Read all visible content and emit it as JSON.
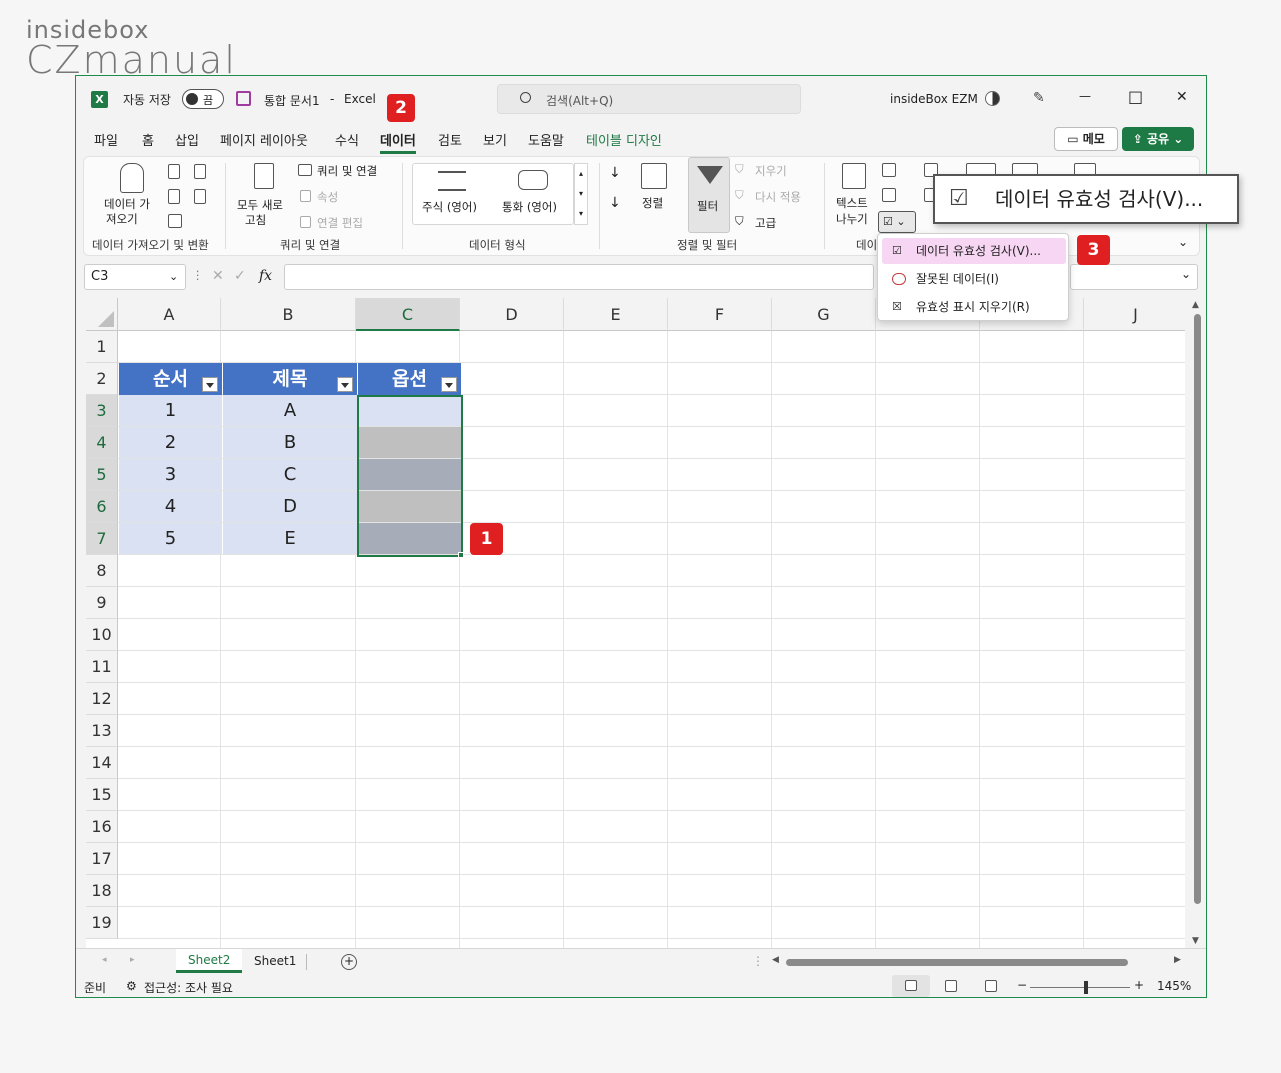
{
  "watermark": {
    "line1": "insidebox",
    "line2": "CZmanual"
  },
  "titlebar": {
    "autosave_label": "자동 저장",
    "autosave_state": "끔",
    "doc_name": "통합 문서1",
    "separator": "-",
    "app_name": "Excel",
    "search_placeholder": "검색(Alt+Q)",
    "user_name": "insideBox EZM",
    "minimize": "—",
    "maximize": "□",
    "close": "✕"
  },
  "menu": {
    "items": [
      "파일",
      "홈",
      "삽입",
      "페이지 레이아웃",
      "수식",
      "데이터",
      "검토",
      "보기",
      "도움말",
      "테이블 디자인"
    ],
    "memo_label": "메모",
    "share_label": "공유"
  },
  "ribbon": {
    "get_data_label_1": "데이터 가",
    "get_data_label_2": "져오기",
    "group_get_transform": "데이터 가져오기 및 변환",
    "refresh_all_1": "모두 새로",
    "refresh_all_2": "고침",
    "queries_connections": "쿼리 및 연결",
    "properties": "속성",
    "edit_links": "연결 편집",
    "group_queries": "쿼리 및 연결",
    "stocks": "주식 (영어)",
    "currencies": "통화 (영어)",
    "group_data_types": "데이터 형식",
    "sort": "정렬",
    "filter": "필터",
    "clear": "지우기",
    "reapply": "다시 적용",
    "advanced": "고급",
    "group_sort_filter": "정렬 및 필터",
    "text_to_cols_1": "텍스트",
    "text_to_cols_2": "나누기",
    "group_data_tools_partial": "데이"
  },
  "formula_bar": {
    "name_box": "C3",
    "fx": "fx",
    "value": ""
  },
  "sheet": {
    "columns": [
      "A",
      "B",
      "C",
      "D",
      "E",
      "F",
      "G",
      "H",
      "I",
      "J"
    ],
    "rows": [
      "1",
      "2",
      "3",
      "4",
      "5",
      "6",
      "7",
      "8",
      "9",
      "10",
      "11",
      "12",
      "13",
      "14",
      "15",
      "16",
      "17",
      "18",
      "19"
    ],
    "table_headers": [
      "순서",
      "제목",
      "옵션"
    ],
    "table_rows": [
      [
        "1",
        "A",
        ""
      ],
      [
        "2",
        "B",
        ""
      ],
      [
        "3",
        "C",
        ""
      ],
      [
        "4",
        "D",
        ""
      ],
      [
        "5",
        "E",
        ""
      ]
    ]
  },
  "badges": {
    "b1": "1",
    "b2": "2",
    "b3": "3"
  },
  "dropdown": {
    "items": [
      "데이터 유효성 검사(V)...",
      "잘못된 데이터(I)",
      "유효성 표시 지우기(R)"
    ]
  },
  "callout": {
    "label": "데이터 유효성 검사(V)..."
  },
  "sheet_tabs": {
    "active": "Sheet2",
    "other": "Sheet1",
    "add": "+"
  },
  "status_bar": {
    "ready": "준비",
    "accessibility": "접근성: 조사 필요",
    "zoom": "145%",
    "zoom_minus": "−",
    "zoom_plus": "+"
  },
  "colors": {
    "excel_green": "#1f7a45",
    "table_header": "#4472c4",
    "band": "#d9e1f2",
    "badge_red": "#e02020",
    "highlight": "#f6d6f2"
  }
}
